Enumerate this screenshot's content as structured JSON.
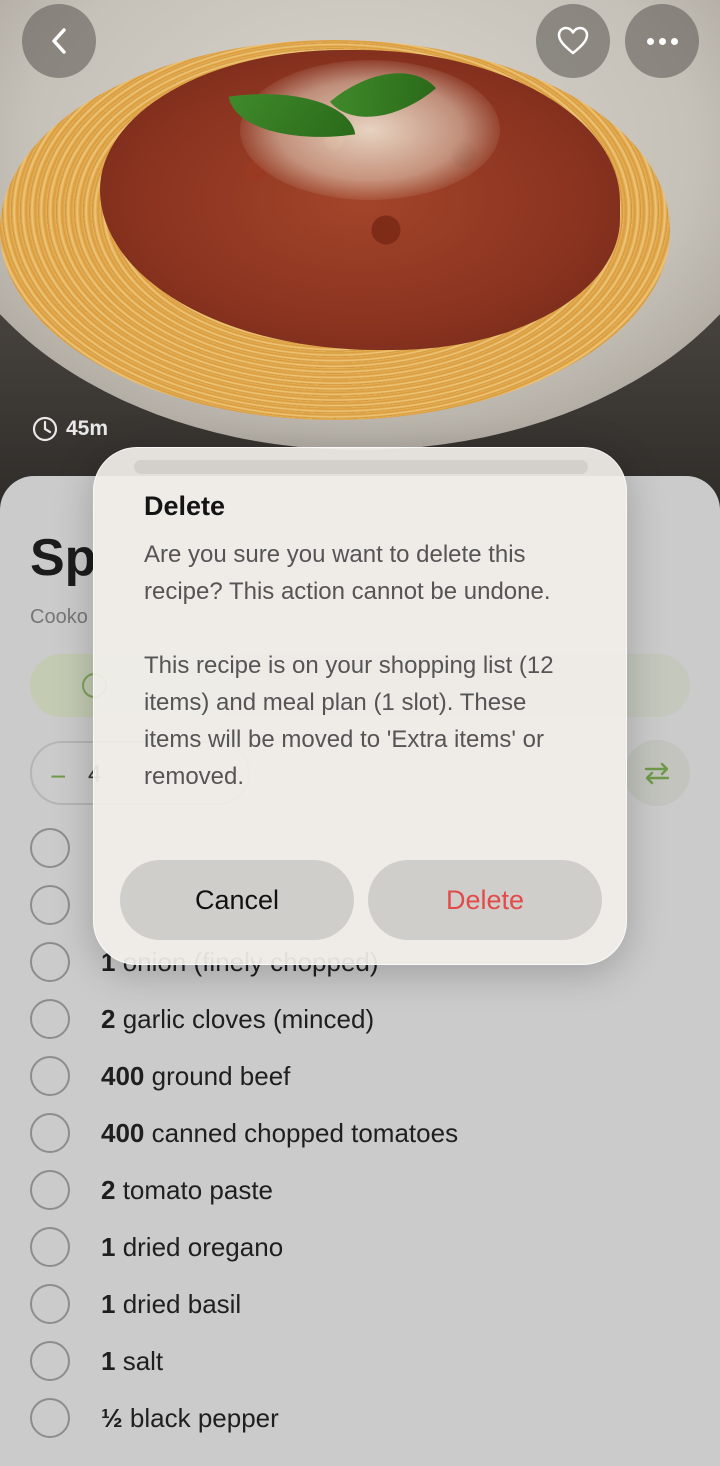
{
  "hero": {
    "time": "45m"
  },
  "recipe": {
    "title_partial": "Sp",
    "subtitle_partial": "Cooko"
  },
  "servings": {
    "minus": "−",
    "value": "4"
  },
  "ingredients": [
    {
      "qty": "1",
      "name": " onion (finely chopped)"
    },
    {
      "qty": "2",
      "name": " garlic cloves (minced)"
    },
    {
      "qty": "400",
      "name": " ground beef"
    },
    {
      "qty": "400",
      "name": " canned chopped tomatoes"
    },
    {
      "qty": "2",
      "name": " tomato paste"
    },
    {
      "qty": "1",
      "name": " dried oregano"
    },
    {
      "qty": "1",
      "name": " dried basil"
    },
    {
      "qty": "1",
      "name": " salt"
    },
    {
      "qty": "½",
      "name": " black pepper"
    }
  ],
  "dialog": {
    "title": "Delete",
    "message": "Are you sure you want to delete this recipe? This action cannot be undone.",
    "detail": "This recipe is on your shopping list (12 items) and meal plan (1 slot). These items will be moved to 'Extra items' or removed.",
    "cancel_label": "Cancel",
    "delete_label": "Delete"
  },
  "colors": {
    "accent_green": "#6f9a4a",
    "destructive_red": "#e34a4a"
  },
  "icons": [
    "back-icon",
    "heart-icon",
    "more-icon",
    "clock-icon",
    "swap-icon"
  ]
}
